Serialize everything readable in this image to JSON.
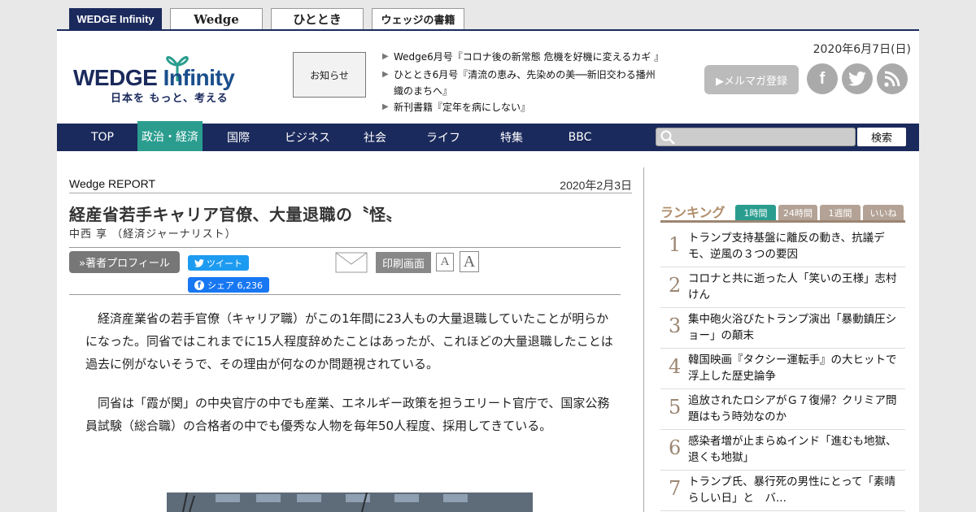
{
  "top_tabs": [
    "WEDGE Infinity",
    "Wedge",
    "ひととき",
    "ウェッジの書籍"
  ],
  "header": {
    "logo_main": "WEDGE",
    "logo_accent": "Infinity",
    "logo_tagline": "日本を もっと、考える",
    "notice_label": "お知らせ",
    "news": [
      "Wedge6月号『コロナ後の新常態 危機を好機に変えるカギ 』",
      "ひととき6月号『清流の恵み、先染めの美──新旧交わる播州織のまちへ』",
      "新刊書籍『定年を病にしない』"
    ],
    "date": "2020年6月7日(日)",
    "mail_button": "▶メルマガ登録",
    "social_icons": [
      "facebook-icon",
      "twitter-icon",
      "rss-icon"
    ]
  },
  "nav": {
    "items": [
      "TOP",
      "政治・経済",
      "国際",
      "ビジネス",
      "社会",
      "ライフ",
      "特集",
      "BBC"
    ],
    "active": "政治・経済",
    "search_button": "検索"
  },
  "article": {
    "category": "Wedge REPORT",
    "date": "2020年2月3日",
    "title": "経産省若手キャリア官僚、大量退職の〝怪〟",
    "author": "中西 享 （経済ジャーナリスト）",
    "profile_button": "»著者プロフィール",
    "tweet_button": "ツイート",
    "share_button": "シェア 6,236",
    "print_button": "印刷画面",
    "font_small": "A",
    "font_large": "A",
    "paragraphs": [
      "経済産業省の若手官僚（キャリア職）がこの1年間に23人もの大量退職していたことが明らかになった。同省ではこれまでに15人程度辞めたことはあったが、これほどの大量退職したことは過去に例がないそうで、その理由が何なのか問題視されている。",
      "同省は「霞が関」の中央官庁の中でも産業、エネルギー政策を担うエリート官庁で、国家公務員試験（総合職）の合格者の中でも優秀な人物を毎年50人程度、採用してきている。"
    ]
  },
  "ranking": {
    "heading": "ランキング",
    "tabs": [
      "1時間",
      "24時間",
      "1週間",
      "いいね"
    ],
    "active_tab": "1時間",
    "items": [
      {
        "rank": "1",
        "title": "トランプ支持基盤に離反の動き、抗議デモ、逆風の３つの要因"
      },
      {
        "rank": "2",
        "title": "コロナと共に逝った人「笑いの王様」志村けん"
      },
      {
        "rank": "3",
        "title": "集中砲火浴びたトランプ演出「暴動鎮圧ショー」の顛末"
      },
      {
        "rank": "4",
        "title": "韓国映画『タクシー運転手』の大ヒットで浮上した歴史論争"
      },
      {
        "rank": "5",
        "title": "追放されたロシアがＧ７復帰？クリミア問題はもう時効なのか"
      },
      {
        "rank": "6",
        "title": "感染者増が止まらぬインド「進むも地獄、退くも地獄」"
      },
      {
        "rank": "7",
        "title": "トランプ氏、暴行死の男性にとって「素晴らしい日」と　バ..."
      }
    ]
  }
}
